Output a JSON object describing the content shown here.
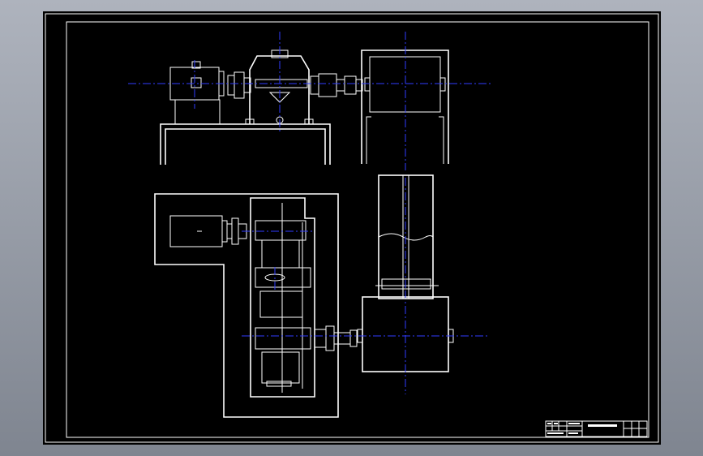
{
  "drawing": {
    "background": "#000000",
    "line_color": "#ffffff",
    "centerline_color": "#2f3cff",
    "frame_color": "#aeb3bd"
  },
  "title_block": {
    "title": "",
    "cells": []
  }
}
